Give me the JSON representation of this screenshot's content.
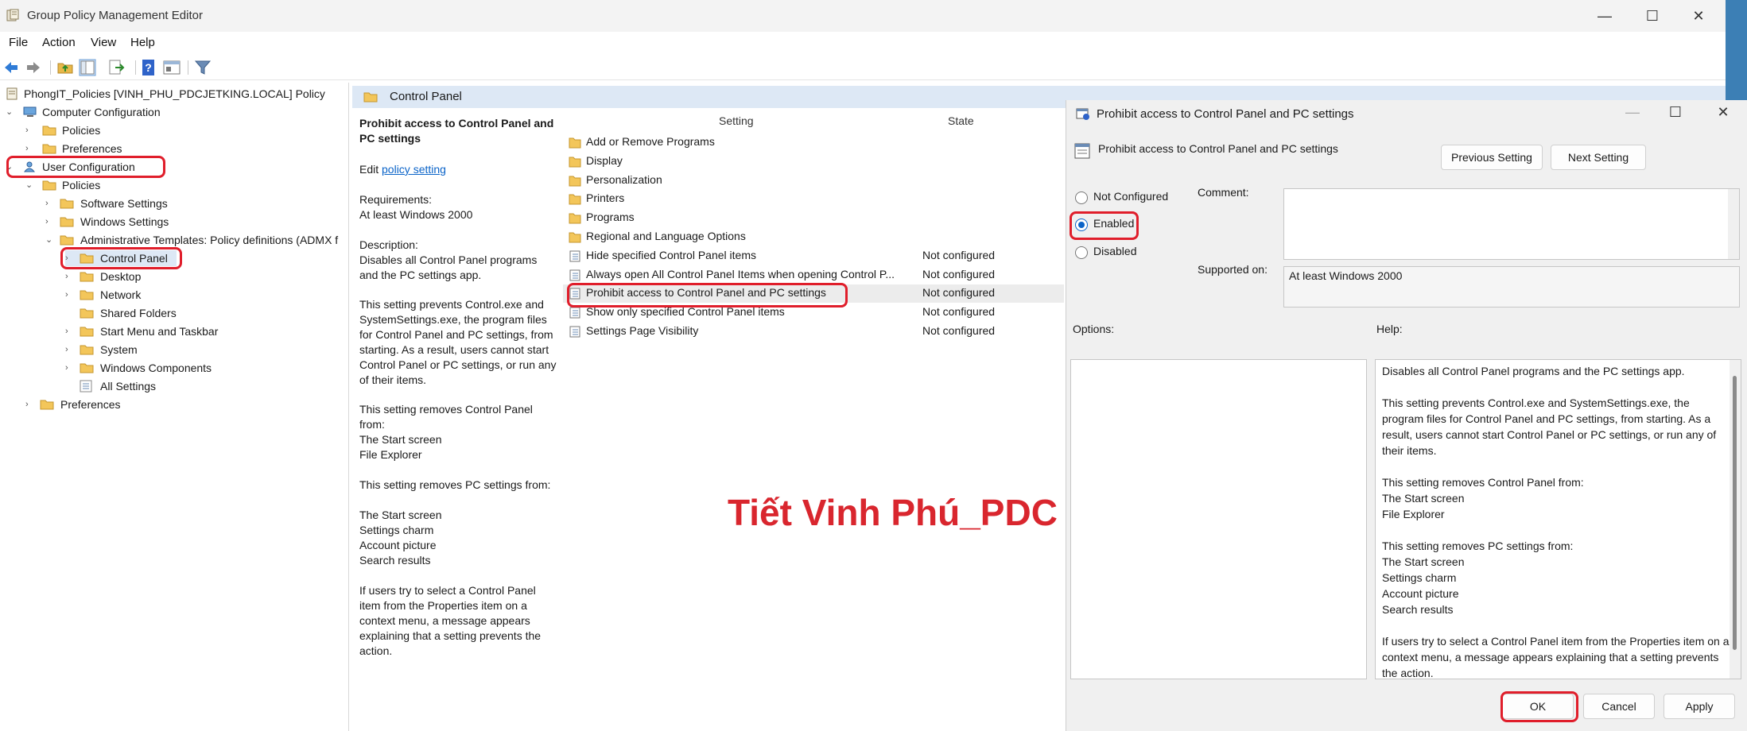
{
  "window": {
    "title": "Group Policy Management Editor",
    "controls": [
      "—",
      "☐",
      "✕"
    ]
  },
  "menu": [
    "File",
    "Action",
    "View",
    "Help"
  ],
  "tree": {
    "root": "PhongIT_Policies [VINH_PHU_PDCJETKING.LOCAL] Policy",
    "computer_configuration": "Computer Configuration",
    "cc_policies": "Policies",
    "cc_preferences": "Preferences",
    "user_configuration": "User Configuration",
    "uc_policies": "Policies",
    "software_settings": "Software Settings",
    "windows_settings": "Windows Settings",
    "admin_templates": "Administrative Templates: Policy definitions (ADMX f",
    "control_panel": "Control Panel",
    "desktop": "Desktop",
    "network": "Network",
    "shared_folders": "Shared Folders",
    "start_menu": "Start Menu and Taskbar",
    "system": "System",
    "windows_components": "Windows Components",
    "all_settings": "All Settings",
    "uc_preferences": "Preferences"
  },
  "center": {
    "header": "Control Panel",
    "desc_title": "Prohibit access to Control Panel and PC settings",
    "edit_prefix": "Edit ",
    "edit_link": "policy setting",
    "requirements_label": "Requirements:",
    "requirements_value": "At least Windows 2000",
    "description_label": "Description:",
    "description_1": "Disables all Control Panel programs and the PC settings app.",
    "description_2": "This setting prevents Control.exe and SystemSettings.exe, the program files for Control Panel and PC settings, from starting. As a result, users cannot start Control Panel or PC settings, or run any of their items.",
    "description_3": "This setting removes Control Panel from:",
    "description_3a": "The Start screen",
    "description_3b": "File Explorer",
    "description_4": "This setting removes PC settings from:",
    "description_4a": "The Start screen",
    "description_4b": "Settings charm",
    "description_4c": "Account picture",
    "description_4d": "Search results",
    "description_5": "If users try to select a Control Panel item from the Properties item on a context menu, a message appears explaining that a setting prevents the action.",
    "col_setting": "Setting",
    "col_state": "State",
    "rows": [
      {
        "name": "Add or Remove Programs",
        "state": "",
        "kind": "folder"
      },
      {
        "name": "Display",
        "state": "",
        "kind": "folder"
      },
      {
        "name": "Personalization",
        "state": "",
        "kind": "folder"
      },
      {
        "name": "Printers",
        "state": "",
        "kind": "folder"
      },
      {
        "name": "Programs",
        "state": "",
        "kind": "folder"
      },
      {
        "name": "Regional and Language Options",
        "state": "",
        "kind": "folder"
      },
      {
        "name": "Hide specified Control Panel items",
        "state": "Not configured",
        "kind": "policy"
      },
      {
        "name": "Always open All Control Panel Items when opening Control P...",
        "state": "Not configured",
        "kind": "policy"
      },
      {
        "name": "Prohibit access to Control Panel and PC settings",
        "state": "Not configured",
        "kind": "policy"
      },
      {
        "name": "Show only specified Control Panel items",
        "state": "Not configured",
        "kind": "policy"
      },
      {
        "name": "Settings Page Visibility",
        "state": "Not configured",
        "kind": "policy"
      }
    ]
  },
  "dialog": {
    "title": "Prohibit access to Control Panel and PC settings",
    "setting_name": "Prohibit access to Control Panel and PC settings",
    "previous_setting": "Previous Setting",
    "next_setting": "Next Setting",
    "not_configured": "Not Configured",
    "enabled": "Enabled",
    "disabled": "Disabled",
    "selected_option": "Enabled",
    "comment_label": "Comment:",
    "supported_on_label": "Supported on:",
    "supported_on_value": "At least Windows 2000",
    "options_label": "Options:",
    "help_label": "Help:",
    "help_text": "Disables all Control Panel programs and the PC settings app.\n\nThis setting prevents Control.exe and SystemSettings.exe, the program files for Control Panel and PC settings, from starting. As a result, users cannot start Control Panel or PC settings, or run any of their items.\n\nThis setting removes Control Panel from:\nThe Start screen\nFile Explorer\n\nThis setting removes PC settings from:\nThe Start screen\nSettings charm\nAccount picture\nSearch results\n\nIf users try to select a Control Panel item from the Properties item on a context menu, a message appears explaining that a setting prevents the action.",
    "ok": "OK",
    "cancel": "Cancel",
    "apply": "Apply",
    "controls": [
      "—",
      "☐",
      "✕"
    ]
  },
  "watermark": "Tiết Vinh Phú_PDC",
  "colors": {
    "highlight_ring": "#e01e2b",
    "selection_bg": "#dde8f5",
    "link": "#0a63c8",
    "watermark": "#d9262e"
  }
}
